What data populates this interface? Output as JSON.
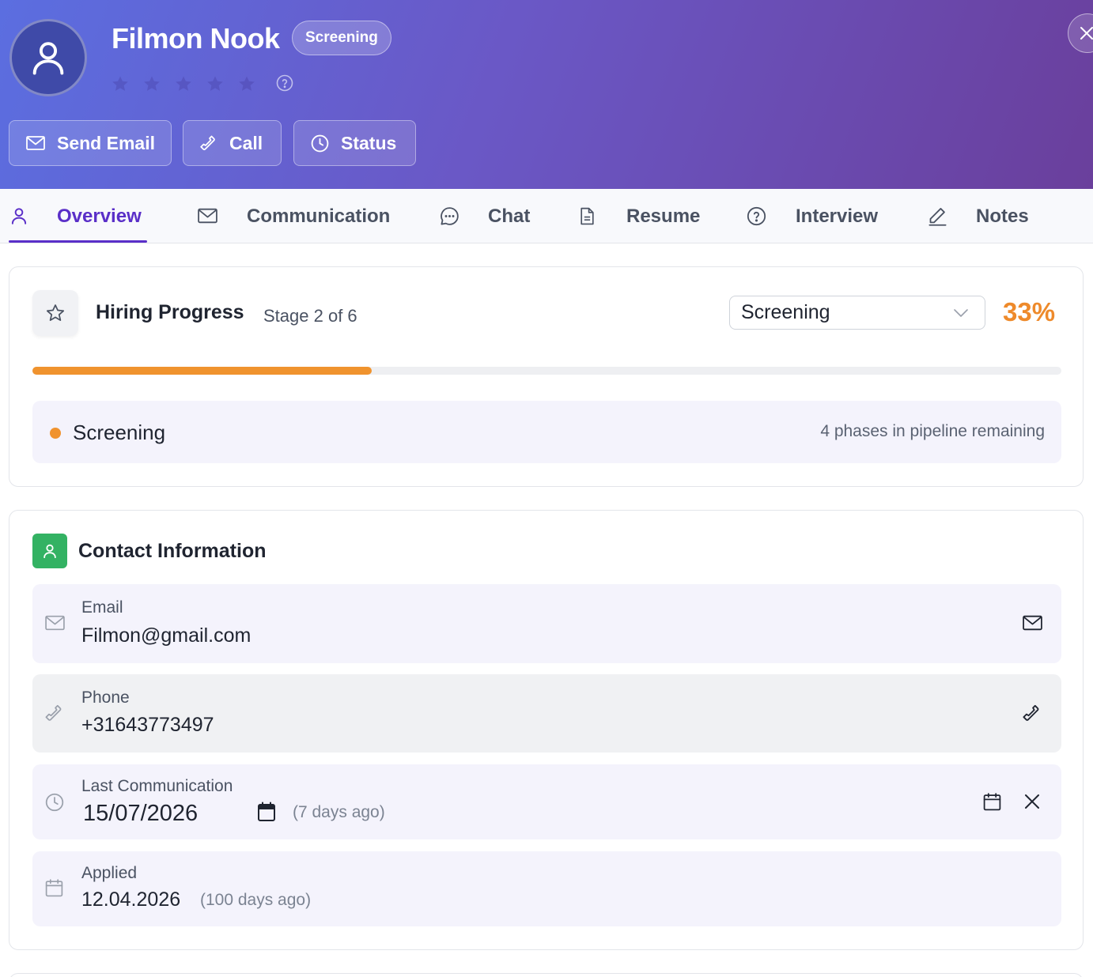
{
  "candidate": {
    "name": "Filmon Nook",
    "status_badge": "Screening",
    "rating": {
      "value": 0,
      "max": 5
    }
  },
  "actions": {
    "send_email": "Send Email",
    "call": "Call",
    "status": "Status"
  },
  "tabs": [
    {
      "label": "Overview",
      "icon": "user-icon",
      "active": true
    },
    {
      "label": "Communication",
      "icon": "mail-icon",
      "active": false
    },
    {
      "label": "Chat",
      "icon": "chat-icon",
      "active": false
    },
    {
      "label": "Resume",
      "icon": "document-icon",
      "active": false
    },
    {
      "label": "Interview",
      "icon": "help-circle-icon",
      "active": false
    },
    {
      "label": "Notes",
      "icon": "pencil-icon",
      "active": false
    }
  ],
  "hiring_progress": {
    "title": "Hiring Progress",
    "stage_text": "Stage 2 of 6",
    "selected_stage": "Screening",
    "percent_label": "33%",
    "progress_fraction": 0.33,
    "current_phase": "Screening",
    "remaining_text": "4 phases in pipeline remaining"
  },
  "contact": {
    "title": "Contact Information",
    "email": {
      "label": "Email",
      "value": "Filmon@gmail.com"
    },
    "phone": {
      "label": "Phone",
      "value": "+31643773497"
    },
    "last_communication": {
      "label": "Last Communication",
      "value": "15/07/2026",
      "relative": "(7 days ago)"
    },
    "applied": {
      "label": "Applied",
      "value": "12.04.2026",
      "relative": "(100 days ago)"
    }
  },
  "colors": {
    "accent": "#5a2fc8",
    "progress": "#f0932e",
    "contact_icon_bg": "#33b263",
    "header_gradient_start": "#5b6ee0",
    "header_gradient_end": "#6a3f9c"
  }
}
